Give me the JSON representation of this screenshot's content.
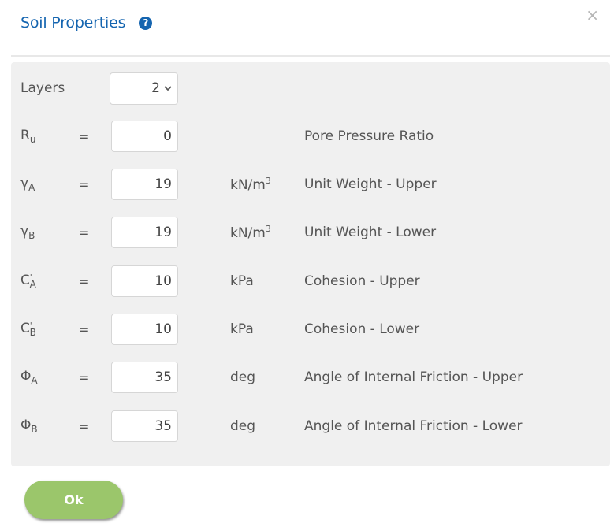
{
  "dialog": {
    "title": "Soil Properties",
    "help_icon": "?",
    "close_icon": "×"
  },
  "layers": {
    "label": "Layers",
    "value": "2"
  },
  "equals": "=",
  "rows": [
    {
      "symbol": "R",
      "sub": "u",
      "sup": "",
      "value": "0",
      "unit": "",
      "unit_sup": "",
      "description": "Pore Pressure Ratio"
    },
    {
      "symbol": "γ",
      "sub": "A",
      "sup": "",
      "value": "19",
      "unit": "kN/m",
      "unit_sup": "3",
      "description": "Unit Weight - Upper"
    },
    {
      "symbol": "γ",
      "sub": "B",
      "sup": "",
      "value": "19",
      "unit": "kN/m",
      "unit_sup": "3",
      "description": "Unit Weight - Lower"
    },
    {
      "symbol": "C",
      "sub": "A",
      "sup": "'",
      "value": "10",
      "unit": "kPa",
      "unit_sup": "",
      "description": "Cohesion - Upper"
    },
    {
      "symbol": "C",
      "sub": "B",
      "sup": "'",
      "value": "10",
      "unit": "kPa",
      "unit_sup": "",
      "description": "Cohesion - Lower"
    },
    {
      "symbol": "Φ",
      "sub": "A",
      "sup": "",
      "value": "35",
      "unit": "deg",
      "unit_sup": "",
      "description": "Angle of Internal Friction - Upper"
    },
    {
      "symbol": "Φ",
      "sub": "B",
      "sup": "",
      "value": "35",
      "unit": "deg",
      "unit_sup": "",
      "description": "Angle of Internal Friction - Lower"
    }
  ],
  "footer": {
    "ok_label": "Ok"
  },
  "colors": {
    "title": "#1565b0",
    "ok_button": "#9bc66b",
    "panel_bg": "#f0f0f0"
  }
}
